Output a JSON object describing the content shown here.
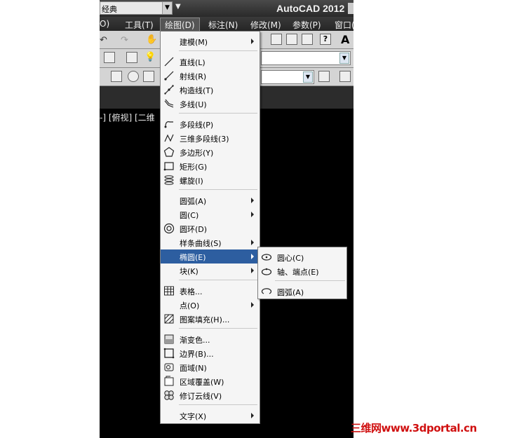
{
  "titlebar": {
    "workspace": "经典",
    "app_title": "AutoCAD 2012"
  },
  "menubar": {
    "items": [
      {
        "label": "O)"
      },
      {
        "label": "工具(T)"
      },
      {
        "label": "绘图(D)"
      },
      {
        "label": "标注(N)"
      },
      {
        "label": "修改(M)"
      },
      {
        "label": "参数(P)"
      },
      {
        "label": "窗口("
      }
    ]
  },
  "viewport": {
    "label": "-] [俯视] [二维"
  },
  "draw_menu": {
    "items": [
      {
        "label": "建模(M)",
        "submenu": true
      },
      {
        "label": "直线(L)"
      },
      {
        "label": "射线(R)"
      },
      {
        "label": "构造线(T)"
      },
      {
        "label": "多线(U)"
      },
      {
        "label": "多段线(P)"
      },
      {
        "label": "三维多段线(3)"
      },
      {
        "label": "多边形(Y)"
      },
      {
        "label": "矩形(G)"
      },
      {
        "label": "螺旋(I)"
      },
      {
        "label": "圆弧(A)",
        "submenu": true
      },
      {
        "label": "圆(C)",
        "submenu": true
      },
      {
        "label": "圆环(D)"
      },
      {
        "label": "样条曲线(S)",
        "submenu": true
      },
      {
        "label": "椭圆(E)",
        "submenu": true
      },
      {
        "label": "块(K)",
        "submenu": true
      },
      {
        "label": "表格..."
      },
      {
        "label": "点(O)",
        "submenu": true
      },
      {
        "label": "图案填充(H)..."
      },
      {
        "label": "渐变色..."
      },
      {
        "label": "边界(B)..."
      },
      {
        "label": "面域(N)"
      },
      {
        "label": "区域覆盖(W)"
      },
      {
        "label": "修订云线(V)"
      },
      {
        "label": "文字(X)",
        "submenu": true
      }
    ]
  },
  "ellipse_submenu": {
    "items": [
      {
        "label": "圆心(C)"
      },
      {
        "label": "轴、端点(E)"
      },
      {
        "label": "圆弧(A)"
      }
    ]
  },
  "watermark": "三维网www.3dportal.cn",
  "colors": {
    "highlight": "#2d5ea0",
    "watermark": "#d01010"
  }
}
